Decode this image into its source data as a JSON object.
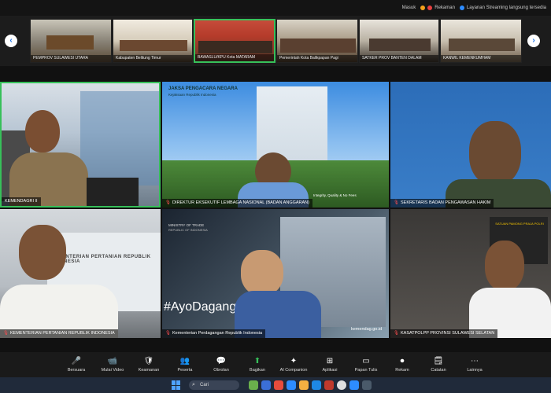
{
  "topbar": {
    "host_label": "Masuk",
    "recording_label": "Rekaman",
    "meeting_label": "Layanan Streaming langsung tersedia",
    "status_colors": {
      "recording": "#e84040",
      "live": "#f3a11c",
      "meeting": "#2d8cff"
    }
  },
  "strip": {
    "left_arrow": "‹",
    "right_arrow": "›",
    "thumbnails": [
      {
        "label": "PEMPROV SULAWESI UTARA"
      },
      {
        "label": "Kabupaten Belitung Timur"
      },
      {
        "label": "BAWASLU/KPU Kota MATARAM"
      },
      {
        "label": "Pemerintah Kota Balikpapan Pagi"
      },
      {
        "label": "SATKER PROV BANTEN DALAM"
      },
      {
        "label": "KANWIL KEMENKUMHAM"
      }
    ]
  },
  "tiles": [
    {
      "label": "KEMENDAGRI II"
    },
    {
      "label": "DIREKTUR EKSEKUTIF LEMBAGA NASIONAL (BADAN ANGGARAN)",
      "banner_title": "JAKSA PENGACARA NEGARA",
      "banner_sub": "Kejaksaan Republik Indonesia",
      "banner_footer": "Integrity, Quality & No Fees"
    },
    {
      "label": "SEKRETARIS BADAN PENGAWASAN HAKIM"
    },
    {
      "label": "KEMENTERIAN PERTANIAN REPUBLIK INDONESIA",
      "sign_text": "KEMENTERIAN PERTANIAN REPUBLIK INDONESIA"
    },
    {
      "label": "Kementerian Perdagangan Republik Indonesia",
      "banner_ministry": "MINISTRY OF TRADE",
      "banner_ministry_sub": "REPUBLIC OF INDONESIA",
      "hashtag": "#AyoDagang",
      "site": "kemendag.go.id"
    },
    {
      "label": "KASATPOLPP PROVINSI SULAWESI SELATAN",
      "patch_text": "SATUAN PAMONG PRAJA POLRI"
    }
  ],
  "toolbar": {
    "buttons": [
      {
        "label": "Bersuara",
        "icon": "mic-icon",
        "glyph": "🎤",
        "badge": "000"
      },
      {
        "label": "Mulai Video",
        "icon": "video-icon",
        "glyph": "📹"
      },
      {
        "label": "Keamanan",
        "icon": "shield-icon",
        "glyph": "🛡"
      },
      {
        "label": "Peserta",
        "icon": "participants-icon",
        "glyph": "👥"
      },
      {
        "label": "Obrolan",
        "icon": "chat-icon",
        "glyph": "💬"
      },
      {
        "label": "Bagikan",
        "icon": "share-icon",
        "glyph": "⬆"
      },
      {
        "label": "AI Companion",
        "icon": "ai-icon",
        "glyph": "✦"
      },
      {
        "label": "Aplikasi",
        "icon": "apps-icon",
        "glyph": "⊞"
      },
      {
        "label": "Papan Tulis",
        "icon": "whiteboard-icon",
        "glyph": "▭"
      },
      {
        "label": "Rekam",
        "icon": "record-icon",
        "glyph": "⏺"
      },
      {
        "label": "Catatan",
        "icon": "notes-icon",
        "glyph": "🗒"
      },
      {
        "label": "Lainnya",
        "icon": "more-icon",
        "glyph": "⋯"
      }
    ]
  },
  "taskbar": {
    "search_placeholder": "Cari"
  }
}
